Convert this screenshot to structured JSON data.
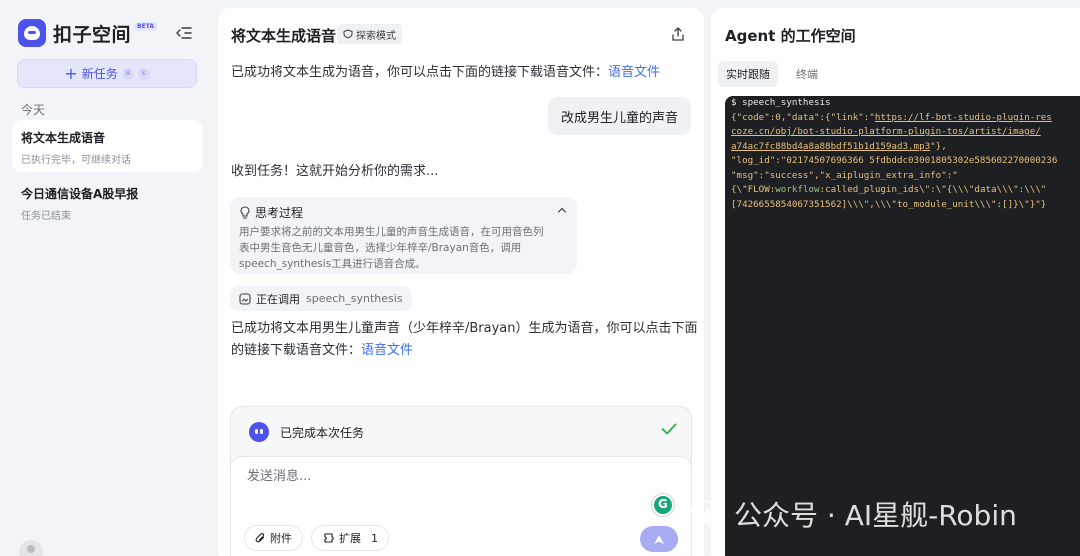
{
  "sidebar": {
    "logo_text": "扣子空间",
    "beta": "BETA",
    "new_task_label": "新任务",
    "shortcut_keys": [
      "⌘",
      "K"
    ],
    "section_today": "今天",
    "tasks": [
      {
        "title": "将文本生成语音",
        "subtitle": "已执行完毕，可继续对话"
      },
      {
        "title": "今日通信设备A股早报",
        "subtitle": "任务已结束"
      }
    ]
  },
  "chat": {
    "title": "将文本生成语音",
    "mode_badge": "探索模式",
    "msg1_text": "已成功将文本生成为语音，你可以点击下面的链接下载语音文件：",
    "msg1_link": "语音文件",
    "user_message": "改成男生儿童的声音",
    "ack": "收到任务！这就开始分析你的需求...",
    "thinking_label": "思考过程",
    "thinking_text_1": "用户要求将之前的文本用男生儿童的声音生成语音，在可用音色列",
    "thinking_text_2": "表中男生音色无儿童音色，选择少年梓辛/Brayan音色，调用",
    "thinking_text_3": "speech_synthesis工具进行语音合成。",
    "calling_label": "正在调用",
    "calling_tool": "speech_synthesis",
    "msg2_line1": "已成功将文本用男生儿童声音（少年梓辛/Brayan）生成为语音，你可以点击下面",
    "msg2_line2": "的链接下载语音文件：",
    "msg2_link": "语音文件",
    "status_done": "已完成本次任务",
    "input_placeholder": "发送消息...",
    "attach_label": "附件",
    "extend_label": "扩展",
    "extend_count": "1"
  },
  "workspace": {
    "title": "Agent 的工作空间",
    "tabs": [
      "实时跟随",
      "终端"
    ],
    "terminal": {
      "command": "$ speech_synthesis",
      "l2_a": "{\"code\":0,\"data\":{\"link\":\"",
      "l2_link": "https://lf-bot-studio-plugin-res",
      "l3_link": "coze.cn/obj/bot-studio-platform-plugin-tos/artist/image/",
      "l4_link": "a74ac7fc88bd4a8a88bdf51b1d159ad3.mp3",
      "l4_b": "\"},",
      "l5": "\"log_id\":\"02174507696366 5fdbddc03001805302e585602270000236",
      "l6": "\"msg\":\"success\",\"x_aiplugin_extra_info\":\"",
      "l7_a": "{\\\"FLOW:",
      "l7_kw": "workflow",
      "l7_b": ":called_plugin_ids\\\":\\\"{\\\\\\\"data\\\\\\\":\\\\\\\"",
      "l8": "[7426655854067351562]\\\\\\\",\\\\\\\"to_module_unit\\\\\\\":[]}\\\"}\"}"
    }
  },
  "watermark": "公众号 · AI星舰-Robin",
  "colors": {
    "accent": "#4d53e8",
    "link": "#3e6ff5",
    "terminal_bg": "#1e1f22"
  }
}
